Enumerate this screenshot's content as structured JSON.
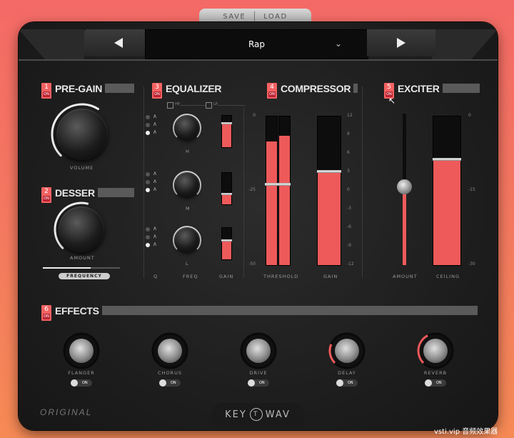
{
  "top_tabs": {
    "save": "SAVE",
    "load": "LOAD"
  },
  "preset": {
    "name": "Rap"
  },
  "pregain": {
    "number": "1",
    "on": "ON",
    "title": "PRE-GAIN",
    "volume_label": "VOLUME",
    "volume_level": 0.62
  },
  "desser": {
    "number": "2",
    "on": "ON",
    "title": "DESSER",
    "amount_label": "AMOUNT",
    "frequency_label": "FREQUENCY",
    "amount_level": 0.55,
    "frequency_level": 0.62
  },
  "equalizer": {
    "number": "3",
    "on": "ON",
    "title": "EQUALIZER",
    "hp_label": "HP",
    "lp_label": "LP",
    "bands": [
      {
        "freq_sub": "H",
        "gain_level": 0.78,
        "selected": 2
      },
      {
        "freq_sub": "M",
        "gain_level": 0.35,
        "selected": 2
      },
      {
        "freq_sub": "L",
        "gain_level": 0.62,
        "selected": 2
      }
    ],
    "col_labels": {
      "q": "Q",
      "freq": "FREQ",
      "gain": "GAIN"
    }
  },
  "compressor": {
    "number": "4",
    "on": "ON",
    "title": "COMPRESSOR",
    "threshold_label": "THRESHOLD",
    "gain_label": "GAIN",
    "left_scale": [
      "0",
      "-25",
      "-50"
    ],
    "right_scale": [
      "12",
      "9",
      "6",
      "3",
      "0",
      "-3",
      "-6",
      "-9",
      "-12"
    ],
    "threshold_level": 0.55,
    "meter_left": 0.83,
    "meter_right": 0.87,
    "gain_level": 0.63
  },
  "exciter": {
    "number": "5",
    "on": "ON",
    "title": "EXCITER",
    "amount_label": "AMOUNT",
    "ceiling_label": "CEILING",
    "right_scale": [
      "0",
      "-15",
      "-30"
    ],
    "amount_level": 0.52,
    "ceiling_level": 0.71
  },
  "effects": {
    "number": "6",
    "on": "ON",
    "title": "EFFECTS",
    "knobs": [
      {
        "label": "FLANGER",
        "toggle": "ON",
        "level": 0.0
      },
      {
        "label": "CHORUS",
        "toggle": "ON",
        "level": 0.0
      },
      {
        "label": "DRIVE",
        "toggle": "ON",
        "level": 0.0
      },
      {
        "label": "DELAY",
        "toggle": "ON",
        "level": 0.25
      },
      {
        "label": "REVERB",
        "toggle": "ON",
        "level": 0.4
      }
    ]
  },
  "footer": {
    "original": "ORIGINAL",
    "logo_left": "KEY",
    "logo_right": "WAV"
  },
  "watermark": "vsti.vip 音频效果器",
  "colors": {
    "accent": "#ee5a5a",
    "panel": "#1f1f1f",
    "background": "#f46a66"
  }
}
